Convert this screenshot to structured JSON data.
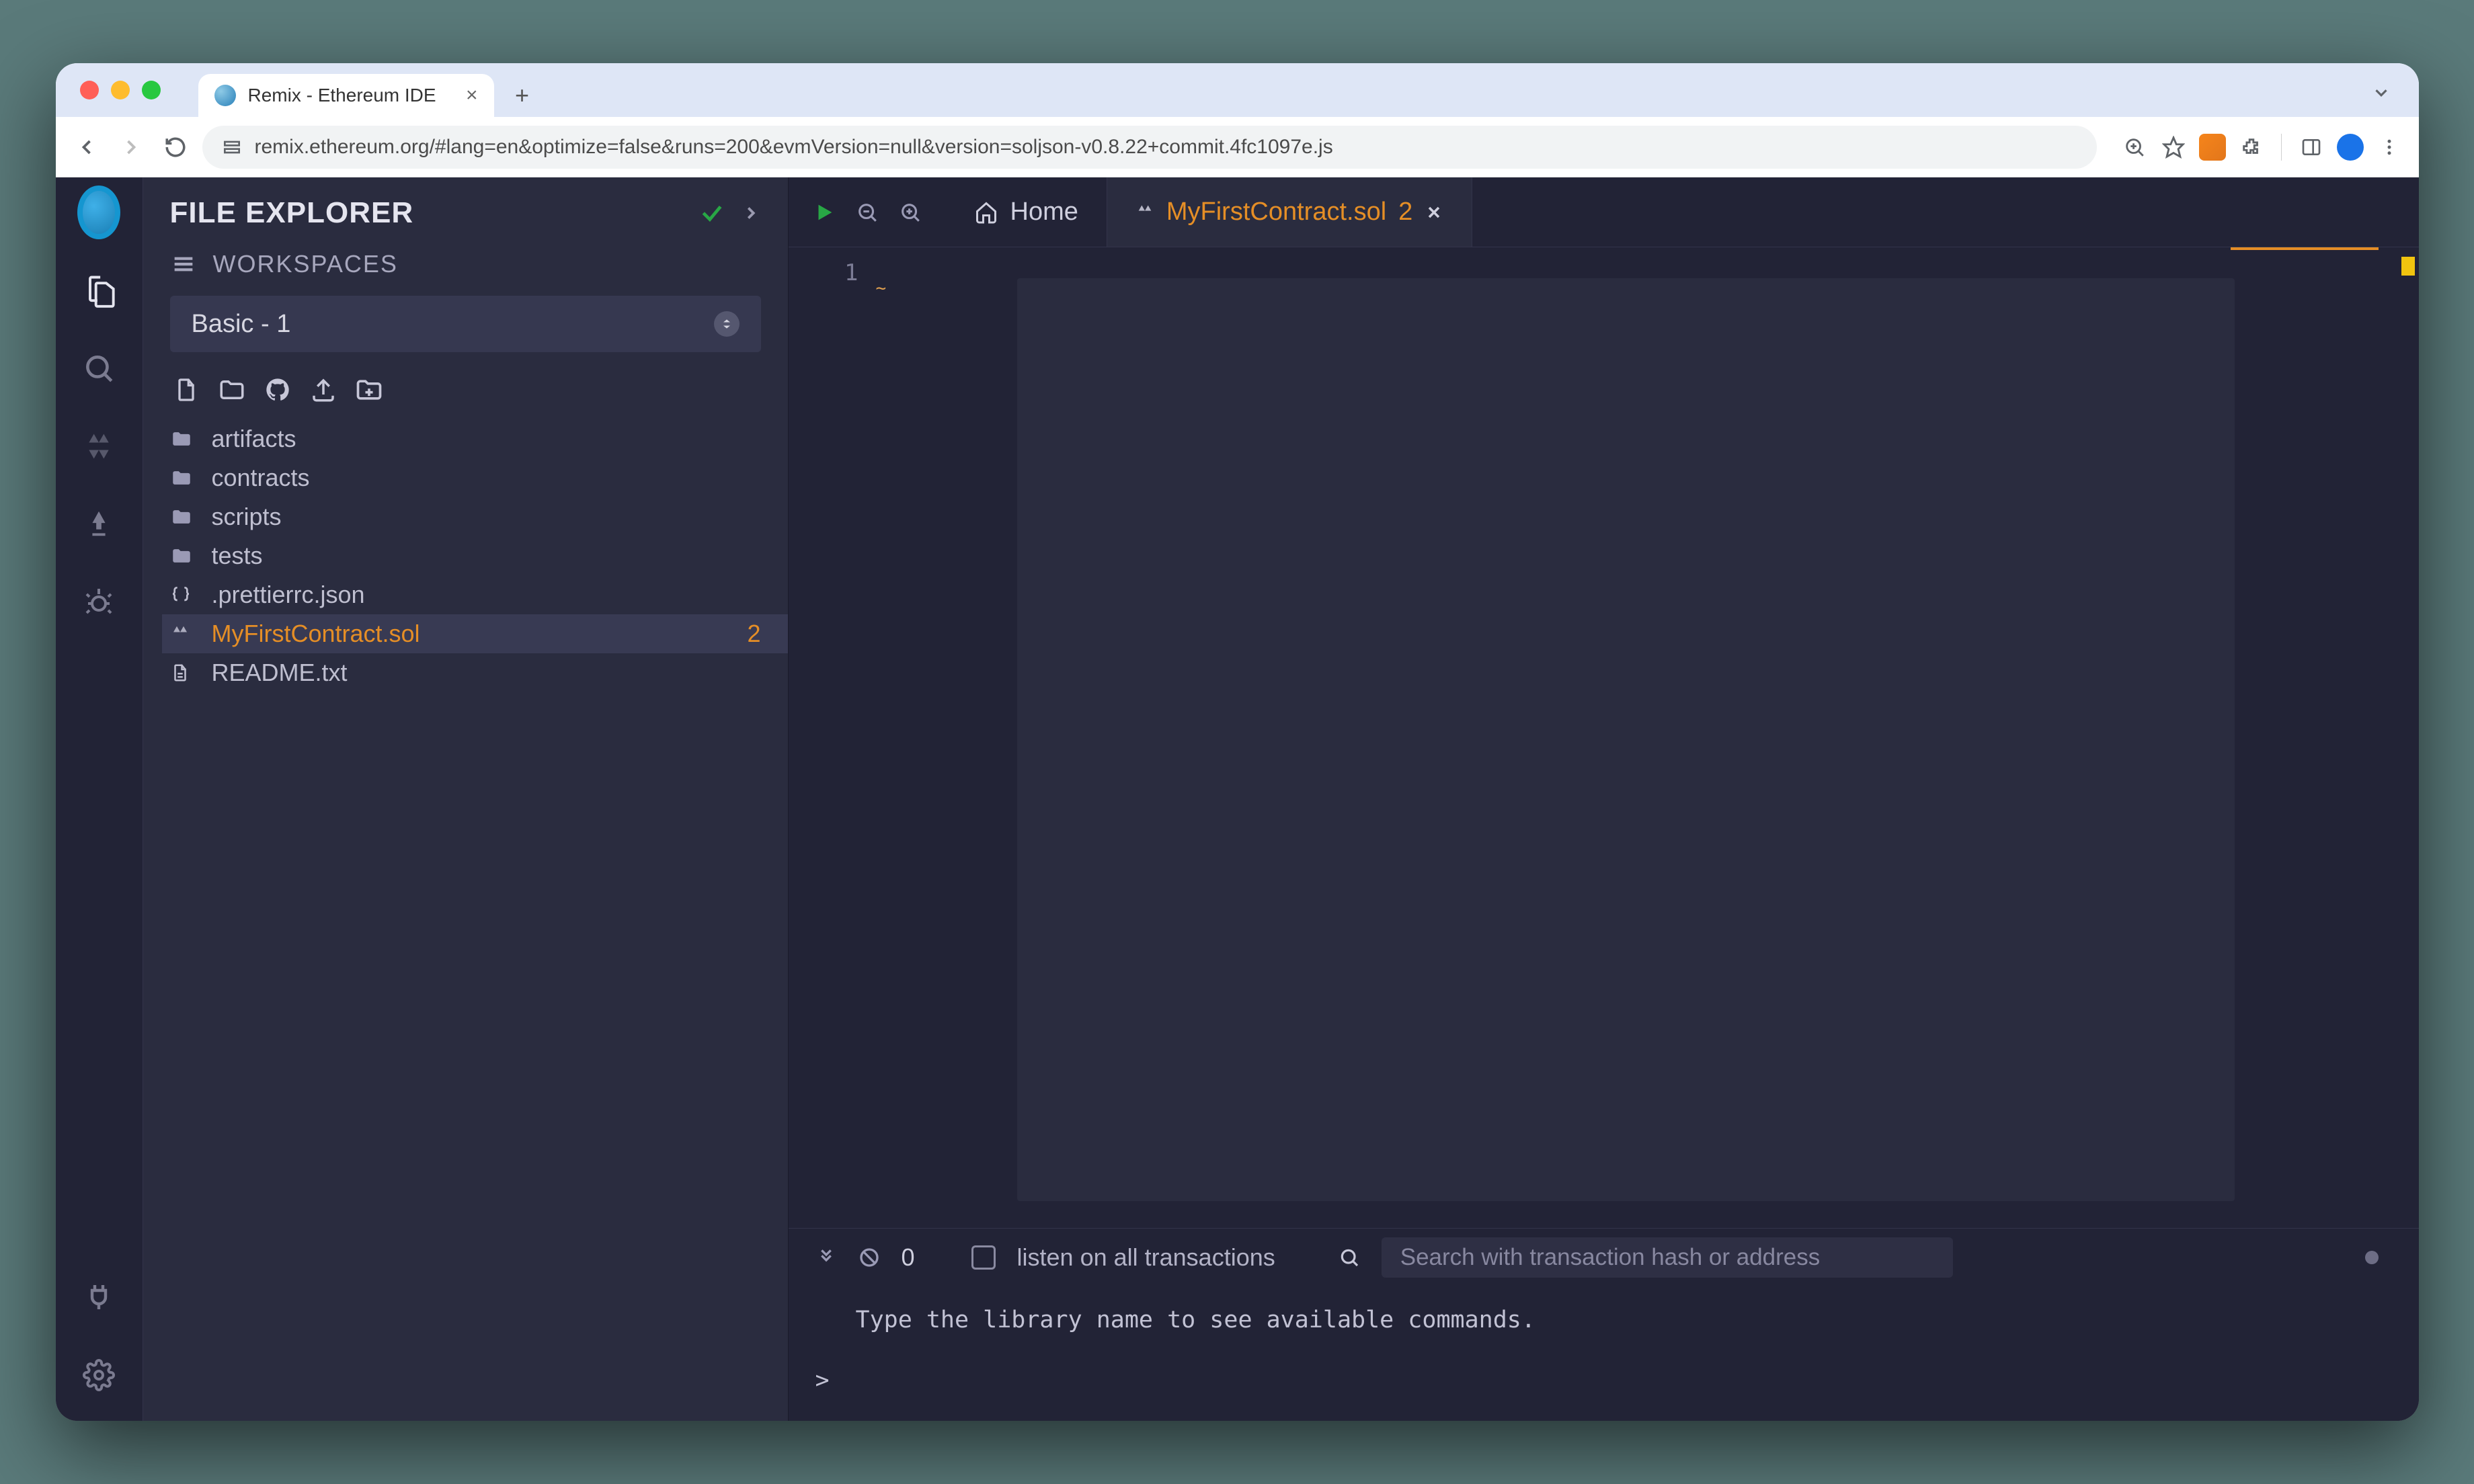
{
  "browser": {
    "tab_title": "Remix - Ethereum IDE",
    "url": "remix.ethereum.org/#lang=en&optimize=false&runs=200&evmVersion=null&version=soljson-v0.8.22+commit.4fc1097e.js"
  },
  "panel": {
    "title": "FILE EXPLORER",
    "workspaces_label": "WORKSPACES",
    "selected_workspace": "Basic - 1"
  },
  "tree": {
    "folders": [
      {
        "name": "artifacts"
      },
      {
        "name": "contracts"
      },
      {
        "name": "scripts"
      },
      {
        "name": "tests"
      }
    ],
    "files": [
      {
        "name": ".prettierrc.json",
        "icon": "braces"
      },
      {
        "name": "MyFirstContract.sol",
        "icon": "sol",
        "active": true,
        "badge": "2"
      },
      {
        "name": "README.txt",
        "icon": "doc"
      }
    ]
  },
  "editor": {
    "tabs": [
      {
        "label": "Home",
        "icon": "home"
      },
      {
        "label": "MyFirstContract.sol",
        "icon": "sol",
        "badge": "2",
        "active": true,
        "closeable": true
      }
    ],
    "gutter_line": "1",
    "squiggle": "~"
  },
  "terminal": {
    "count": "0",
    "listen_label": "listen on all transactions",
    "search_placeholder": "Search with transaction hash or address",
    "hint": "Type the library name to see available commands.",
    "prompt": ">"
  }
}
